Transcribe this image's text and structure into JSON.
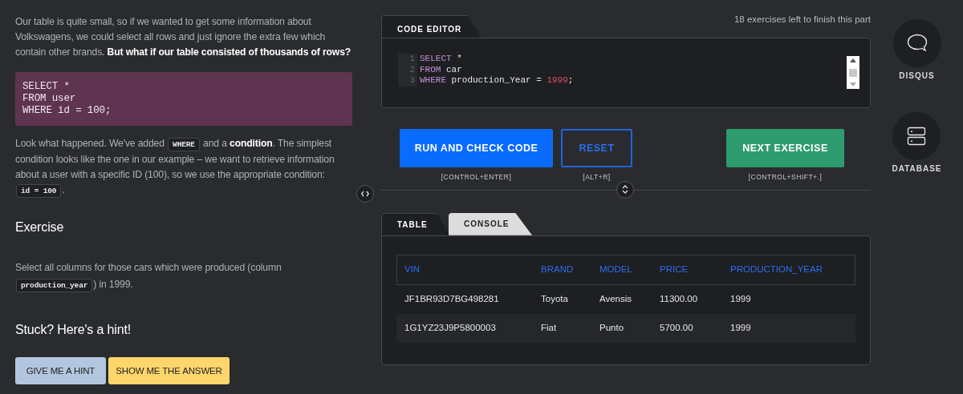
{
  "lesson": {
    "paragraphs": [
      [
        {
          "kind": "text",
          "text": "Our table is quite small, so if we wanted to get some information about Volkswagens, we could select all rows and just ignore the extra few which contain other brands. **But what if our table consisted of thousands of rows?**"
        }
      ],
      [
        {
          "kind": "code_block",
          "lines": [
            "SELECT *",
            "FROM user",
            "WHERE id = 100;"
          ]
        }
      ],
      [
        {
          "kind": "text",
          "text": "Look what happened. We've added "
        },
        {
          "kind": "code",
          "text": "WHERE"
        },
        {
          "kind": "text",
          "text": " and a **condition**. The simplest condition looks like the one in our example – we want to retrieve information about a user with a specific ID (100), so we use the appropriate condition: "
        },
        {
          "kind": "code",
          "text": "id = 100"
        },
        {
          "kind": "text",
          "text": "."
        }
      ]
    ],
    "exercise_title": "Exercise",
    "exercise_text": [
      {
        "kind": "text",
        "text": "Select all columns for those cars which were produced (column "
      },
      {
        "kind": "code",
        "text": "production_year"
      },
      {
        "kind": "text",
        "text": ") in 1999."
      }
    ],
    "hint_title": "Stuck? Here's a hint!",
    "hint_buttons": [
      {
        "label": "GIVE ME A HINT",
        "kind": "hint"
      },
      {
        "label": "SHOW ME THE ANSWER",
        "kind": "answer"
      }
    ]
  },
  "progress_text": "18 exercises left to finish this part",
  "editor": {
    "tab": "CODE EDITOR",
    "lines": [
      {
        "number": "1",
        "tokens": [
          {
            "kind": "keyword",
            "text": "SELECT"
          },
          {
            "kind": "plain",
            "text": " *"
          }
        ]
      },
      {
        "number": "2",
        "tokens": [
          {
            "kind": "keyword",
            "text": "FROM"
          },
          {
            "kind": "plain",
            "text": " car"
          }
        ]
      },
      {
        "number": "3",
        "tokens": [
          {
            "kind": "keyword",
            "text": "WHERE"
          },
          {
            "kind": "plain",
            "text": " production_Year = "
          },
          {
            "kind": "number",
            "text": "1999"
          },
          {
            "kind": "plain",
            "text": ";"
          }
        ]
      }
    ]
  },
  "actions": [
    {
      "label": "RUN AND CHECK CODE",
      "shortcut": "[CONTROL+ENTER]",
      "kind": "primary"
    },
    {
      "label": "RESET",
      "shortcut": "[ALT+R]",
      "kind": "outline"
    },
    {
      "label": "NEXT EXERCISE",
      "shortcut": "[CONTROL+SHIFT+.]",
      "kind": "success"
    }
  ],
  "result_tabs": [
    {
      "label": "TABLE",
      "selected": true
    },
    {
      "label": "CONSOLE",
      "selected": false
    }
  ],
  "table": {
    "columns": [
      "VIN",
      "BRAND",
      "MODEL",
      "PRICE",
      "PRODUCTION_YEAR"
    ],
    "rows": [
      [
        "JF1BR93D7BG498281",
        "Toyota",
        "Avensis",
        "11300.00",
        "1999"
      ],
      [
        "1G1YZ23J9P5800003",
        "Fiat",
        "Punto",
        "5700.00",
        "1999"
      ]
    ]
  },
  "sidebar": [
    {
      "label": "DISQUS",
      "kind": "chat"
    },
    {
      "label": "DATABASE",
      "kind": "database"
    }
  ]
}
